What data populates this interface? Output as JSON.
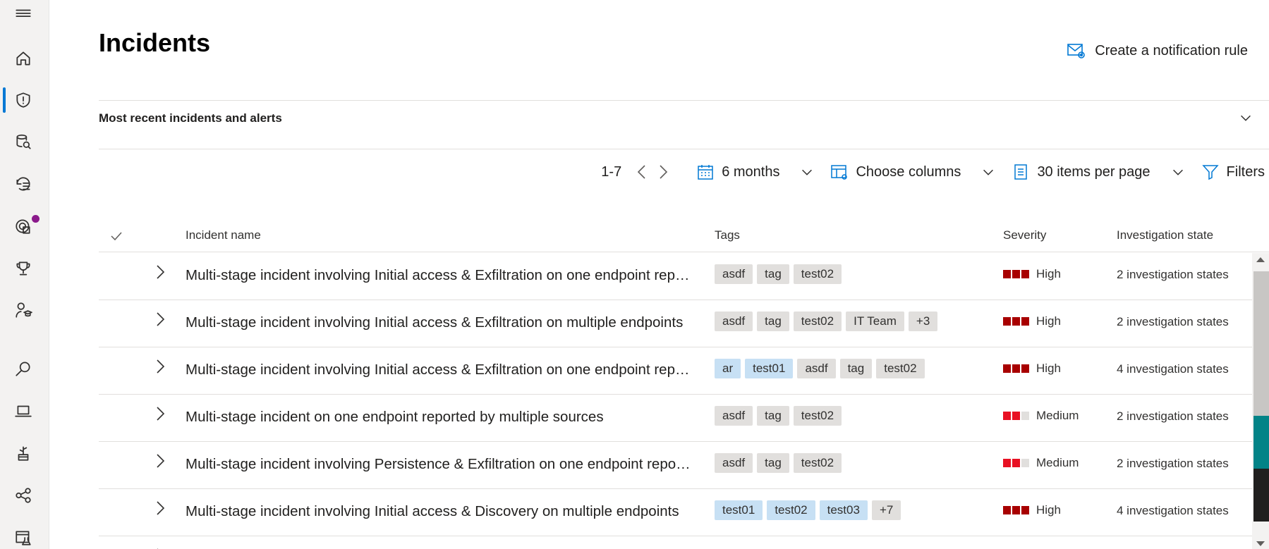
{
  "page": {
    "title": "Incidents"
  },
  "header": {
    "notification_rule_label": "Create a notification rule"
  },
  "recent_section": {
    "label": "Most recent incidents and alerts"
  },
  "toolbar": {
    "page_range": "1-7",
    "time_range": "6 months",
    "choose_columns": "Choose columns",
    "items_per_page": "30 items per page",
    "filters": "Filters"
  },
  "table": {
    "headers": {
      "name": "Incident name",
      "tags": "Tags",
      "severity": "Severity",
      "investigation_state": "Investigation state"
    },
    "rows": [
      {
        "name": "Multi-stage incident involving Initial access & Exfiltration on one endpoint reported by multiple sources",
        "tags": [
          {
            "label": "asdf",
            "style": "gray"
          },
          {
            "label": "tag",
            "style": "gray"
          },
          {
            "label": "test02",
            "style": "gray"
          }
        ],
        "severity": "High",
        "severity_level": 3,
        "investigation_state": "2 investigation states"
      },
      {
        "name": "Multi-stage incident involving Initial access & Exfiltration on multiple endpoints",
        "tags": [
          {
            "label": "asdf",
            "style": "gray"
          },
          {
            "label": "tag",
            "style": "gray"
          },
          {
            "label": "test02",
            "style": "gray"
          },
          {
            "label": "IT Team",
            "style": "gray"
          },
          {
            "label": "+3",
            "style": "gray"
          }
        ],
        "severity": "High",
        "severity_level": 3,
        "investigation_state": "2 investigation states"
      },
      {
        "name": "Multi-stage incident involving Initial access & Exfiltration on one endpoint reported by multiple sources",
        "tags": [
          {
            "label": "ar",
            "style": "blue"
          },
          {
            "label": "test01",
            "style": "blue"
          },
          {
            "label": "asdf",
            "style": "gray"
          },
          {
            "label": "tag",
            "style": "gray"
          },
          {
            "label": "test02",
            "style": "gray"
          }
        ],
        "severity": "High",
        "severity_level": 3,
        "investigation_state": "4 investigation states"
      },
      {
        "name": "Multi-stage incident on one endpoint reported by multiple sources",
        "tags": [
          {
            "label": "asdf",
            "style": "gray"
          },
          {
            "label": "tag",
            "style": "gray"
          },
          {
            "label": "test02",
            "style": "gray"
          }
        ],
        "severity": "Medium",
        "severity_level": 2,
        "investigation_state": "2 investigation states"
      },
      {
        "name": "Multi-stage incident involving Persistence & Exfiltration on one endpoint reported by multiple sources",
        "tags": [
          {
            "label": "asdf",
            "style": "gray"
          },
          {
            "label": "tag",
            "style": "gray"
          },
          {
            "label": "test02",
            "style": "gray"
          }
        ],
        "severity": "Medium",
        "severity_level": 2,
        "investigation_state": "2 investigation states"
      },
      {
        "name": "Multi-stage incident involving Initial access & Discovery on multiple endpoints",
        "tags": [
          {
            "label": "test01",
            "style": "blue"
          },
          {
            "label": "test02",
            "style": "blue"
          },
          {
            "label": "test03",
            "style": "blue"
          },
          {
            "label": "+7",
            "style": "gray"
          }
        ],
        "severity": "High",
        "severity_level": 3,
        "investigation_state": "4 investigation states"
      }
    ]
  },
  "nav_icons": [
    "hamburger-icon",
    "home-icon",
    "shield-icon",
    "database-search-icon",
    "history-list-icon",
    "threat-analytics-icon",
    "trophy-icon",
    "learning-hub-icon",
    "search-icon",
    "laptop-icon",
    "plant-icon",
    "graph-nodes-icon",
    "lab-icon"
  ],
  "colors": {
    "accent": "#0078d4",
    "severity_high": "#a80000",
    "severity_medium": "#e81123",
    "tag_blue": "#c7e0f4",
    "tag_gray": "#e1dfdd"
  }
}
